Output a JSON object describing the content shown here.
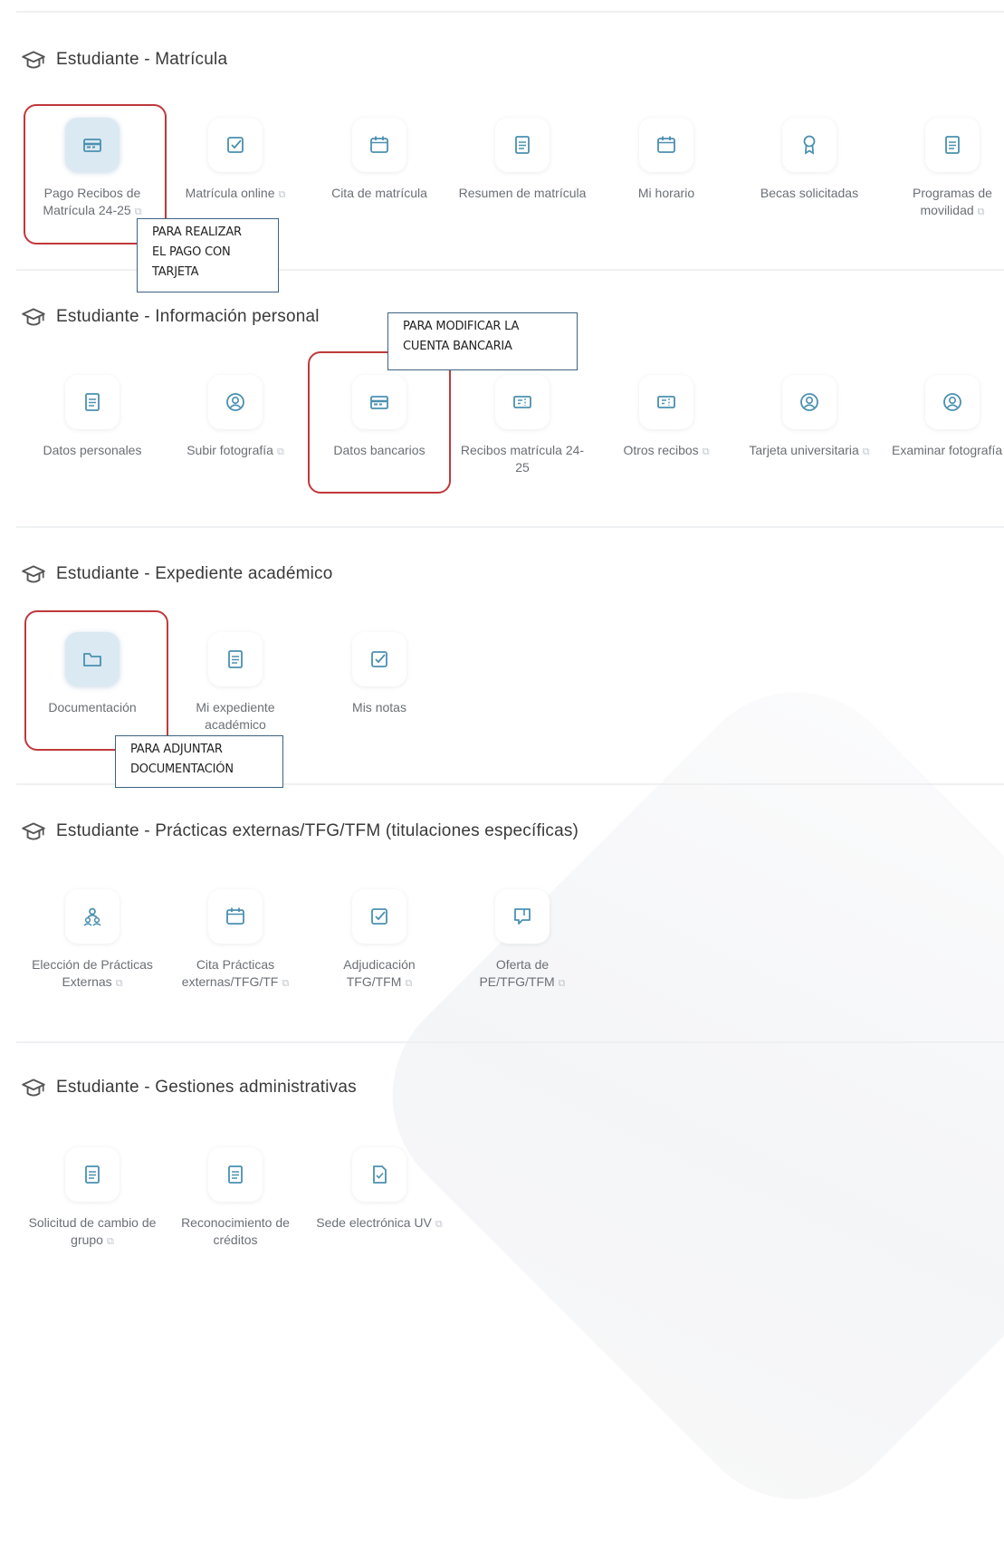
{
  "colors": {
    "icon": "#4a90b0",
    "highlight": "#c0393b",
    "note_border": "#3e6280"
  },
  "sections": [
    {
      "title": "Estudiante - Matrícula",
      "tiles": [
        {
          "label": "Pago Recibos de Matrícula 24-25",
          "icon": "payment-card-icon",
          "external": true,
          "active": true
        },
        {
          "label": "Matrícula online",
          "icon": "checkbox-icon",
          "external": true
        },
        {
          "label": "Cita de matrícula",
          "icon": "calendar-icon",
          "external": false
        },
        {
          "label": "Resumen de matrícula",
          "icon": "document-icon",
          "external": false
        },
        {
          "label": "Mi horario",
          "icon": "calendar-icon",
          "external": false
        },
        {
          "label": "Becas solicitadas",
          "icon": "award-icon",
          "external": false
        },
        {
          "label": "Programas de movilidad",
          "icon": "document-icon",
          "external": true
        }
      ]
    },
    {
      "title": "Estudiante - Información personal",
      "tiles": [
        {
          "label": "Datos personales",
          "icon": "document-icon",
          "external": false
        },
        {
          "label": "Subir fotografía",
          "icon": "user-circle-icon",
          "external": true
        },
        {
          "label": "Datos bancarios",
          "icon": "payment-card-icon",
          "external": false
        },
        {
          "label": "Recibos matrícula 24-25",
          "icon": "ticket-icon",
          "external": false
        },
        {
          "label": "Otros recibos",
          "icon": "ticket-icon",
          "external": true
        },
        {
          "label": "Tarjeta universitaria",
          "icon": "user-circle-icon",
          "external": true
        },
        {
          "label": "Examinar fotografía",
          "icon": "user-circle-icon",
          "external": true
        }
      ]
    },
    {
      "title": "Estudiante - Expediente académico",
      "tiles": [
        {
          "label": "Documentación",
          "icon": "folder-icon",
          "external": false,
          "active": true
        },
        {
          "label": "Mi expediente académico",
          "icon": "document-icon",
          "external": false
        },
        {
          "label": "Mis notas",
          "icon": "checkbox-icon",
          "external": false
        }
      ]
    },
    {
      "title": "Estudiante - Prácticas externas/TFG/TFM (titulaciones específicas)",
      "tiles": [
        {
          "label": "Elección de Prácticas Externas",
          "icon": "users-icon",
          "external": true
        },
        {
          "label": "Cita Prácticas externas/TFG/TF",
          "icon": "calendar-icon",
          "external": true
        },
        {
          "label": "Adjudicación TFG/TFM",
          "icon": "checkbox-icon",
          "external": true
        },
        {
          "label": "Oferta de PE/TFG/TFM",
          "icon": "bookmark-icon",
          "external": true
        }
      ]
    },
    {
      "title": "Estudiante - Gestiones administrativas",
      "tiles": [
        {
          "label": "Solicitud de cambio de grupo",
          "icon": "document-icon",
          "external": true
        },
        {
          "label": "Reconocimiento de créditos",
          "icon": "document-icon",
          "external": false
        },
        {
          "label": "Sede electrónica UV",
          "icon": "file-icon",
          "external": true
        }
      ]
    }
  ],
  "notes": {
    "payment": [
      "PARA REALIZAR",
      "EL PAGO CON",
      "TARJETA"
    ],
    "bank": [
      "PARA MODIFICAR LA",
      "CUENTA BANCARIA"
    ],
    "docs": [
      "PARA ADJUNTAR",
      "DOCUMENTACIÓN"
    ]
  }
}
